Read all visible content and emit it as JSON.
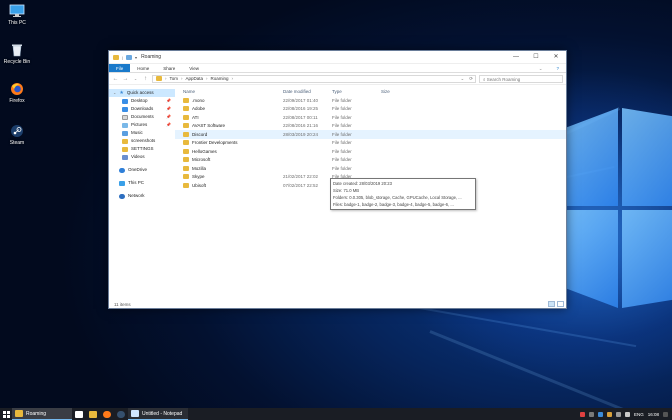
{
  "desktop": {
    "icons": [
      {
        "label": "This PC",
        "icon": "this-pc-icon"
      },
      {
        "label": "Recycle Bin",
        "icon": "recycle-bin-icon"
      },
      {
        "label": "Firefox",
        "icon": "firefox-icon"
      },
      {
        "label": "Steam",
        "icon": "steam-icon"
      }
    ]
  },
  "explorer": {
    "title": "Roaming",
    "ribbon": {
      "file": "File",
      "home": "Home",
      "share": "Share",
      "view": "View"
    },
    "breadcrumb": [
      "Tom",
      "AppData",
      "Roaming"
    ],
    "search_placeholder": "Search Roaming",
    "nav": {
      "quick_access": "Quick access",
      "items": [
        {
          "label": "Desktop",
          "icon": "desktop-folder-icon",
          "pinned": true
        },
        {
          "label": "Downloads",
          "icon": "downloads-folder-icon",
          "pinned": true
        },
        {
          "label": "Documents",
          "icon": "documents-folder-icon",
          "pinned": true
        },
        {
          "label": "Pictures",
          "icon": "pictures-folder-icon",
          "pinned": true
        },
        {
          "label": "Music",
          "icon": "music-folder-icon",
          "pinned": false
        },
        {
          "label": "screenshots",
          "icon": "folder-icon",
          "pinned": false
        },
        {
          "label": "SETTINGS",
          "icon": "folder-icon",
          "pinned": false
        },
        {
          "label": "Videos",
          "icon": "videos-folder-icon",
          "pinned": false
        }
      ],
      "onedrive": "OneDrive",
      "this_pc": "This PC",
      "network": "Network"
    },
    "columns": {
      "name": "Name",
      "date": "Date modified",
      "type": "Type",
      "size": "Size"
    },
    "files": [
      {
        "name": ".mono",
        "date": "22/09/2017 01:40",
        "type": "File folder"
      },
      {
        "name": "Adobe",
        "date": "22/08/2016 19:25",
        "type": "File folder"
      },
      {
        "name": "ATI",
        "date": "22/08/2017 00:11",
        "type": "File folder"
      },
      {
        "name": "AVAST Software",
        "date": "22/08/2016 21:16",
        "type": "File folder"
      },
      {
        "name": "Discord",
        "date": "28/03/2019 20:24",
        "type": "File folder"
      },
      {
        "name": "Frontier Developments",
        "date": "",
        "type": "File folder"
      },
      {
        "name": "HelloGames",
        "date": "",
        "type": "File folder"
      },
      {
        "name": "Microsoft",
        "date": "",
        "type": "File folder"
      },
      {
        "name": "Mozilla",
        "date": "",
        "type": "File folder"
      },
      {
        "name": "Skype",
        "date": "21/02/2017 22:02",
        "type": "File folder"
      },
      {
        "name": "Ubisoft",
        "date": "07/02/2017 22:52",
        "type": "File folder"
      }
    ],
    "hovered_index": 4,
    "tooltip": [
      "Date created: 28/03/2019 20:23",
      "Size: 71.0 MB",
      "Folders: 0.0.305, blob_storage, Cache, GPUCache, Local Storage, ...",
      "Files: badge-1, badge-2, badge-3, badge-4, badge-5, badge-6, ..."
    ],
    "status": "11 items"
  },
  "taskbar": {
    "apps": [
      {
        "label": "Roaming",
        "icon": "file-explorer-icon"
      },
      {
        "label": "Untitled - Notepad",
        "icon": "notepad-icon"
      }
    ],
    "tray": {
      "lang": "ENG",
      "time": "16:08"
    }
  },
  "colors": {
    "accent": "#1979ca",
    "folder": "#e8b93d",
    "selection": "#cce8ff",
    "hover": "#e5f3ff",
    "taskbar": "#1a1d24"
  }
}
